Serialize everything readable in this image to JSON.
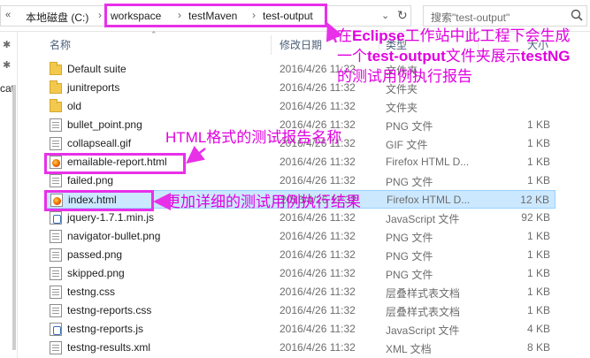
{
  "address": {
    "back_chev": "«",
    "crumbs": [
      "本地磁盘 (C:)",
      "workspace",
      "testMaven",
      "test-output"
    ],
    "separator": "›",
    "dropdown_icon": "chevron-down-icon",
    "refresh_icon": "refresh-icon"
  },
  "search": {
    "placeholder": "搜索\"test-output\"",
    "icon": "search-icon"
  },
  "nav": {
    "label_partial": "cat",
    "pin_glyph": "✱"
  },
  "columns": {
    "name": "名称",
    "date": "修改日期",
    "type": "类型",
    "size": "大小"
  },
  "files": [
    {
      "name": "Default suite",
      "date": "2016/4/26 11:32",
      "type": "文件夹",
      "size": "",
      "icon": "folder"
    },
    {
      "name": "junitreports",
      "date": "2016/4/26 11:32",
      "type": "文件夹",
      "size": "",
      "icon": "folder"
    },
    {
      "name": "old",
      "date": "2016/4/26 11:32",
      "type": "文件夹",
      "size": "",
      "icon": "folder"
    },
    {
      "name": "bullet_point.png",
      "date": "2016/4/26 11:32",
      "type": "PNG 文件",
      "size": "1 KB",
      "icon": "file"
    },
    {
      "name": "collapseall.gif",
      "date": "2016/4/26 11:32",
      "type": "GIF 文件",
      "size": "1 KB",
      "icon": "file"
    },
    {
      "name": "emailable-report.html",
      "date": "2016/4/26 11:32",
      "type": "Firefox HTML D...",
      "size": "1 KB",
      "icon": "fx"
    },
    {
      "name": "failed.png",
      "date": "2016/4/26 11:32",
      "type": "PNG 文件",
      "size": "1 KB",
      "icon": "file"
    },
    {
      "name": "index.html",
      "date": "2016/4/26 11:32",
      "type": "Firefox HTML D...",
      "size": "12 KB",
      "icon": "fx",
      "selected": true
    },
    {
      "name": "jquery-1.7.1.min.js",
      "date": "2016/4/26 11:32",
      "type": "JavaScript 文件",
      "size": "92 KB",
      "icon": "js"
    },
    {
      "name": "navigator-bullet.png",
      "date": "2016/4/26 11:32",
      "type": "PNG 文件",
      "size": "1 KB",
      "icon": "file"
    },
    {
      "name": "passed.png",
      "date": "2016/4/26 11:32",
      "type": "PNG 文件",
      "size": "1 KB",
      "icon": "file"
    },
    {
      "name": "skipped.png",
      "date": "2016/4/26 11:32",
      "type": "PNG 文件",
      "size": "1 KB",
      "icon": "file"
    },
    {
      "name": "testng.css",
      "date": "2016/4/26 11:32",
      "type": "层叠样式表文档",
      "size": "1 KB",
      "icon": "file"
    },
    {
      "name": "testng-reports.css",
      "date": "2016/4/26 11:32",
      "type": "层叠样式表文档",
      "size": "1 KB",
      "icon": "file"
    },
    {
      "name": "testng-reports.js",
      "date": "2016/4/26 11:32",
      "type": "JavaScript 文件",
      "size": "4 KB",
      "icon": "js"
    },
    {
      "name": "testng-results.xml",
      "date": "2016/4/26 11:32",
      "type": "XML 文档",
      "size": "8 KB",
      "icon": "file"
    }
  ],
  "annotations": {
    "top_line1_pre": "在",
    "top_line1_bold": "Eclipse",
    "top_line1_post": "工作站中此工程下会生成",
    "top_line2_pre": "一个",
    "top_line2_bold": "test-output",
    "top_line2_mid": "文件夹展示",
    "top_line2_bold2": "testNG",
    "top_line3": "的测试用例执行报告",
    "mid": "HTML格式的测试报告名称",
    "index": "更加详细的测试用例执行结果",
    "color": "#e830e8"
  }
}
